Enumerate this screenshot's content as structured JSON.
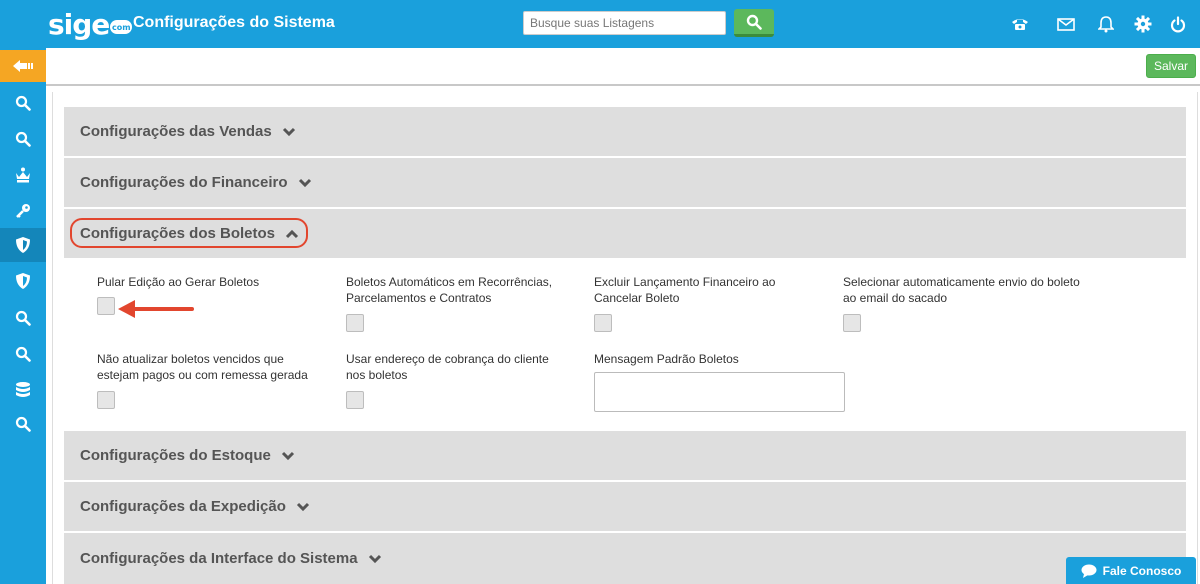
{
  "header": {
    "logo_text": "sige",
    "logo_badge": "com",
    "title": "Configurações do Sistema",
    "search_placeholder": "Busque suas Listagens",
    "icons": [
      "phone-icon",
      "mail-icon",
      "bell-icon",
      "gear-icon",
      "power-icon"
    ]
  },
  "sidebar": {
    "items": [
      "back-arrow-icon",
      "search-icon",
      "search-icon",
      "crown-icon",
      "key-icon",
      "shield-icon",
      "shield-icon",
      "search-icon",
      "search-icon",
      "database-icon",
      "search-icon"
    ],
    "active": "shield-icon"
  },
  "toolbar": {
    "save_label": "Salvar"
  },
  "sections": [
    {
      "title": "Configurações das Vendas",
      "expanded": false
    },
    {
      "title": "Configurações do Financeiro",
      "expanded": false
    },
    {
      "title": "Configurações dos Boletos",
      "expanded": true
    },
    {
      "title": "Configurações do Estoque",
      "expanded": false
    },
    {
      "title": "Configurações da Expedição",
      "expanded": false
    },
    {
      "title": "Configurações da Interface do Sistema",
      "expanded": false
    }
  ],
  "boletos": {
    "fields": [
      {
        "label": "Pular Edição ao Gerar Boletos",
        "checked": false
      },
      {
        "label": "Boletos Automáticos em Recorrências, Parcelamentos e Contratos",
        "checked": false
      },
      {
        "label": "Excluir Lançamento Financeiro ao Cancelar Boleto",
        "checked": false
      },
      {
        "label": "Selecionar automaticamente envio do boleto ao email do sacado",
        "checked": false
      },
      {
        "label": "Não atualizar boletos vencidos que estejam pagos ou com remessa gerada",
        "checked": false
      },
      {
        "label": "Usar endereço de cobrança do cliente nos boletos",
        "checked": false
      }
    ],
    "message_label": "Mensagem Padrão Boletos",
    "message_value": ""
  },
  "chat": {
    "label": "Fale Conosco"
  },
  "colors": {
    "primary": "#1aa0dc",
    "success": "#5cb85c",
    "accent": "#f5a623",
    "annotation": "#e2462e"
  }
}
